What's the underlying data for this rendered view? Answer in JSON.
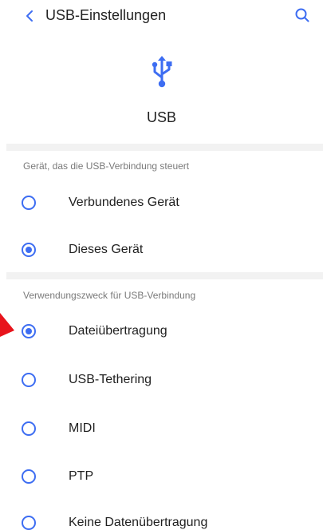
{
  "header": {
    "title": "USB-Einstellungen",
    "back_icon": "chevron-left-icon",
    "search_icon": "search-icon"
  },
  "hero": {
    "icon": "usb-icon",
    "label": "USB"
  },
  "sections": [
    {
      "header": "Gerät, das die USB-Verbindung steuert",
      "options": [
        {
          "label": "Verbundenes Gerät",
          "checked": false
        },
        {
          "label": "Dieses Gerät",
          "checked": true
        }
      ]
    },
    {
      "header": "Verwendungszweck für USB-Verbindung",
      "options": [
        {
          "label": "Dateiübertragung",
          "checked": true
        },
        {
          "label": "USB-Tethering",
          "checked": false
        },
        {
          "label": "MIDI",
          "checked": false
        },
        {
          "label": "PTP",
          "checked": false
        },
        {
          "label": "Keine Datenübertragung",
          "checked": false
        }
      ]
    }
  ],
  "colors": {
    "accent": "#3d6df2",
    "annotation": "#e8141c",
    "divider": "#f2f2f2",
    "section_header_text": "#7a7a7a"
  }
}
